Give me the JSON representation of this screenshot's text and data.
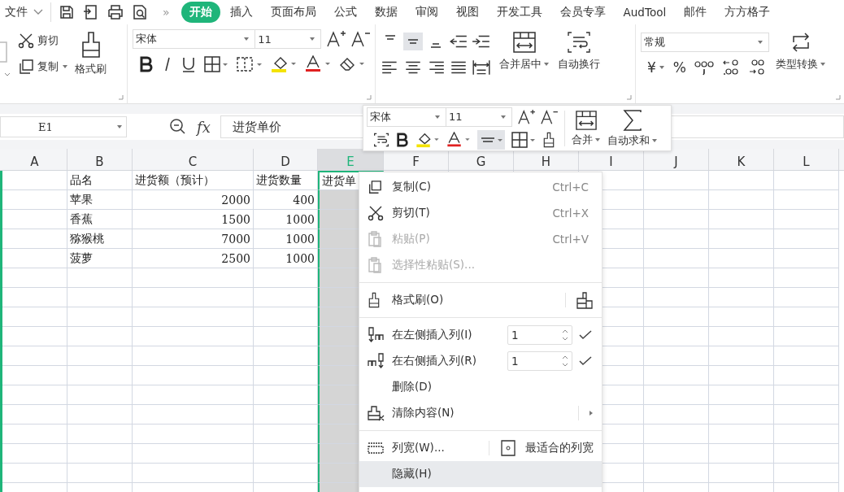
{
  "top_bar": {
    "file_menu": "文件",
    "more": "»",
    "tabs": [
      {
        "label": "开始",
        "selected": true
      },
      {
        "label": "插入",
        "selected": false
      },
      {
        "label": "页面布局",
        "selected": false
      },
      {
        "label": "公式",
        "selected": false
      },
      {
        "label": "数据",
        "selected": false
      },
      {
        "label": "审阅",
        "selected": false
      },
      {
        "label": "视图",
        "selected": false
      },
      {
        "label": "开发工具",
        "selected": false
      },
      {
        "label": "会员专享",
        "selected": false
      },
      {
        "label": "AudTool",
        "selected": false
      },
      {
        "label": "邮件",
        "selected": false
      },
      {
        "label": "方方格子",
        "selected": false
      }
    ]
  },
  "ribbon": {
    "cut": "剪切",
    "copy": "复制",
    "format_painter": "格式刷",
    "font": "宋体",
    "font_size": "11",
    "vertical_align": [
      {
        "selected": false
      },
      {
        "selected": true
      },
      {
        "selected": false
      }
    ],
    "merge": "合并居中",
    "wrap": "自动换行",
    "number_format": "常规",
    "currency": "¥",
    "percent": "%",
    "convert": "类型转换"
  },
  "formula_bar": {
    "name_box": "E1",
    "function_label": "fx",
    "formula": "进货单价"
  },
  "sheet": {
    "columns": [
      {
        "label": "A",
        "selected": false
      },
      {
        "label": "B",
        "selected": false
      },
      {
        "label": "C",
        "selected": false
      },
      {
        "label": "D",
        "selected": false
      },
      {
        "label": "E",
        "selected": true
      },
      {
        "label": "F",
        "selected": false
      },
      {
        "label": "G",
        "selected": false
      },
      {
        "label": "H",
        "selected": false
      },
      {
        "label": "I",
        "selected": false
      },
      {
        "label": "J",
        "selected": false
      },
      {
        "label": "K",
        "selected": false
      },
      {
        "label": "L",
        "selected": false
      }
    ],
    "rows": [
      [
        {
          "text": "",
          "kind": "text"
        },
        {
          "text": "品名",
          "kind": "text"
        },
        {
          "text": "进货额（预计）",
          "kind": "text"
        },
        {
          "text": "进货数量",
          "kind": "text"
        },
        {
          "text": "进货单",
          "kind": "text"
        }
      ],
      [
        {
          "text": "",
          "kind": "text"
        },
        {
          "text": "苹果",
          "kind": "text"
        },
        {
          "text": "2000",
          "kind": "number"
        },
        {
          "text": "400",
          "kind": "number"
        }
      ],
      [
        {
          "text": "",
          "kind": "text"
        },
        {
          "text": "香蕉",
          "kind": "text"
        },
        {
          "text": "1500",
          "kind": "number"
        },
        {
          "text": "1000",
          "kind": "number"
        }
      ],
      [
        {
          "text": "",
          "kind": "text"
        },
        {
          "text": "猕猴桃",
          "kind": "text"
        },
        {
          "text": "7000",
          "kind": "number"
        },
        {
          "text": "1000",
          "kind": "number"
        }
      ],
      [
        {
          "text": "",
          "kind": "text"
        },
        {
          "text": "菠萝",
          "kind": "text"
        },
        {
          "text": "2500",
          "kind": "number"
        },
        {
          "text": "1000",
          "kind": "number"
        }
      ]
    ]
  },
  "mini_toolbar": {
    "font": "宋体",
    "font_size": "11",
    "align_button": {
      "selected": true
    },
    "merge": "合并",
    "autosum": "自动求和"
  },
  "context_menu": {
    "items": [
      {
        "kind": "item",
        "label": "复制(C)",
        "shortcut": "Ctrl+C",
        "disabled": false,
        "selected": false
      },
      {
        "kind": "item",
        "label": "剪切(T)",
        "shortcut": "Ctrl+X",
        "disabled": false,
        "selected": false
      },
      {
        "kind": "item",
        "label": "粘贴(P)",
        "shortcut": "Ctrl+V",
        "disabled": true,
        "selected": false
      },
      {
        "kind": "item",
        "label": "选择性粘贴(S)...",
        "disabled": true,
        "selected": false
      },
      {
        "kind": "separator"
      },
      {
        "kind": "item",
        "label": "格式刷(O)",
        "side_icon": true,
        "disabled": false,
        "selected": false
      },
      {
        "kind": "separator"
      },
      {
        "kind": "spin",
        "label": "在左侧插入列(I)",
        "value": "1",
        "disabled": false,
        "selected": false
      },
      {
        "kind": "spin",
        "label": "在右侧插入列(R)",
        "value": "1",
        "disabled": false,
        "selected": false
      },
      {
        "kind": "item",
        "label": "删除(D)",
        "disabled": false,
        "selected": false
      },
      {
        "kind": "item",
        "label": "清除内容(N)",
        "submenu": true,
        "disabled": false,
        "selected": false
      },
      {
        "kind": "separator"
      },
      {
        "kind": "split",
        "label": "列宽(W)...",
        "second_label": "最适合的列宽",
        "disabled": false,
        "selected": false
      },
      {
        "kind": "item",
        "label": "隐藏(H)",
        "disabled": false,
        "selected": true
      }
    ]
  }
}
